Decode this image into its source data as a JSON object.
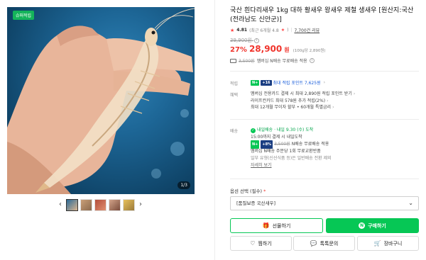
{
  "gallery": {
    "badge": "슈퍼적립",
    "counter": "1/3",
    "prev_arrow": "‹",
    "next_arrow": "›",
    "thumbnail_count": 5
  },
  "product": {
    "title": "국산 흰다리새우 1kg 대하 활새우 왕새우 제철 생새우 [원산지:국산(전라남도 신안군)]",
    "rating": {
      "icon": "star-icon",
      "score": "4.81",
      "recent": "(최근 6개월 4.8",
      "recent_icon": "star-icon",
      "recent_close": ")",
      "reviews": "7,700건 리뷰"
    },
    "original_price": "39,900원",
    "discount": "27%",
    "sale_price": "28,900",
    "won": "원",
    "unit_price": "(100g당 2,890원)",
    "shipping": {
      "icon": "truck-icon",
      "fee": "3,500원",
      "text": "멤버십 N배송 무료배송 적용",
      "info_icon": "info-icon"
    }
  },
  "points": {
    "label": "적립",
    "npay_badge": "N+",
    "grade_badge": "+16",
    "text": "최대 적립 포인트 7,625원",
    "chevron": "›"
  },
  "benefits": {
    "label": "혜택",
    "items": [
      "멤버십 전용카드 결제 시 최대 2,890원 적립 포인트 받기",
      "라이프컨카드 최대 578원 추가 적립(2%)",
      "최대 12개월 무이자 할부 • 60개월 특별금리"
    ],
    "chevron": "›"
  },
  "delivery": {
    "label": "배송",
    "arrival_badge": "내일배송",
    "arrival_text": "· 내일 9.30 (수) 도착",
    "cutoff": "15:00까지 결제 시 내일도착",
    "npay_badge": "N+",
    "npay_grade": "+8%",
    "fee": "3,500원",
    "free_text": "N배송 무료배송 적용",
    "exchange": "멤버십 N배송 주문당 1회 무료교환반품",
    "restrictions": "일부 유형(신선식품 등)은 일반배송 전환 제외",
    "more": "자세히 보기"
  },
  "options": {
    "label": "옵션 선택 (필수)",
    "required_mark": "*",
    "selected": "[품질보증 국산새우]",
    "caret_icon": "chevron-down-icon"
  },
  "actions": {
    "gift": "선물하기",
    "gift_icon": "gift-icon",
    "buy": "구매하기",
    "buy_icon": "naver-n-icon",
    "like": "찜하기",
    "like_icon": "heart-icon",
    "talk": "톡톡문의",
    "talk_icon": "chat-icon",
    "cart": "장바구니",
    "cart_icon": "cart-icon"
  },
  "colors": {
    "accent_green": "#06c755",
    "price_red": "#f0342c",
    "points_blue": "#1b5edb"
  }
}
